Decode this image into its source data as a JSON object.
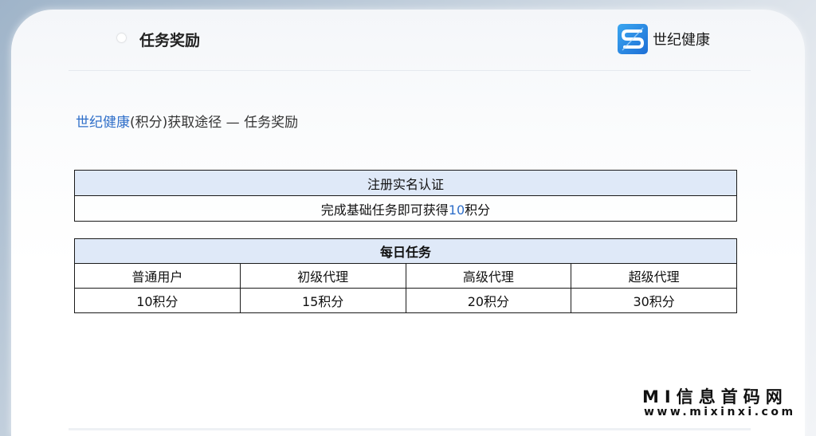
{
  "header": {
    "title": "任务奖励",
    "logo_text": "世纪健康"
  },
  "subtitle": {
    "brand": "世纪健康",
    "rest": "(积分)获取途径 — 任务奖励"
  },
  "registration_table": {
    "header": "注册实名认证",
    "row_prefix": "完成基础任务即可获得",
    "row_value": "10",
    "row_suffix": "积分"
  },
  "daily_table": {
    "header": "每日任务",
    "columns": [
      "普通用户",
      "初级代理",
      "高级代理",
      "超级代理"
    ],
    "values": [
      "10积分",
      "15积分",
      "20积分",
      "30积分"
    ]
  },
  "watermark": {
    "title": "MI信息首码网",
    "url": "www.mixinxi.com"
  },
  "colors": {
    "brand_blue": "#2f6fc9",
    "table_header_bg": "#dfe9f8"
  }
}
